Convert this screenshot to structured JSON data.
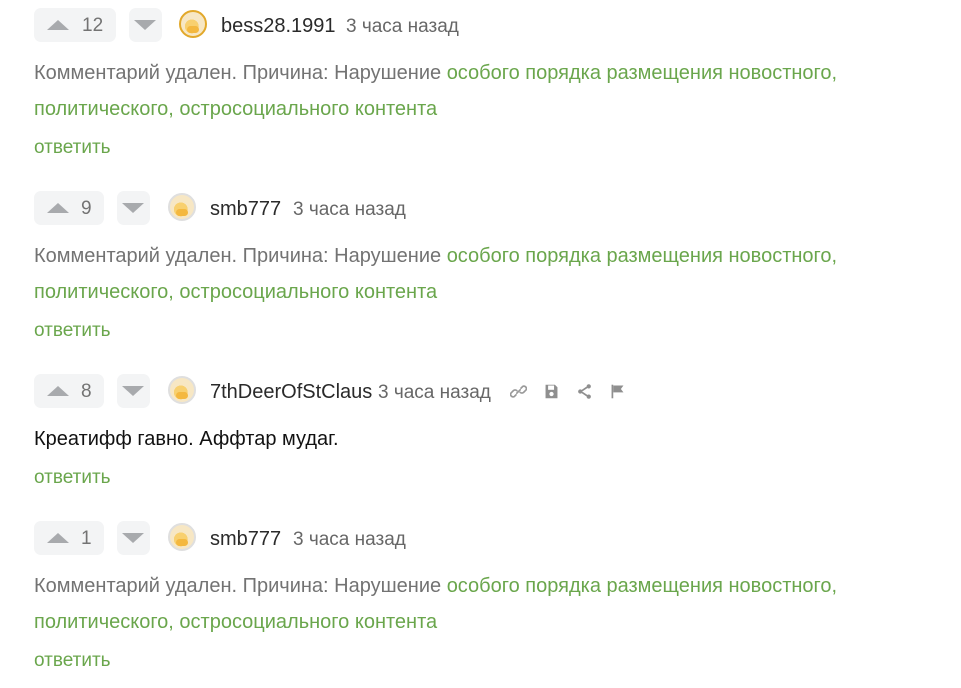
{
  "comments": [
    {
      "score": "12",
      "username": "bess28.1991",
      "time": "3 часа назад",
      "deleted": true,
      "text_prefix": "Комментарий удален. Причина: Нарушение",
      "text_link": "особого порядка размещения новостного, политического, остросоциального контента",
      "reply_label": "ответить"
    },
    {
      "score": "9",
      "username": "smb777",
      "time": "3 часа назад",
      "deleted": true,
      "text_prefix": "Комментарий удален. Причина: Нарушение",
      "text_link": "особого порядка размещения новостного, политического, остросоциального контента",
      "reply_label": "ответить"
    },
    {
      "score": "8",
      "username": "7thDeerOfStClaus",
      "time": "3 часа назад",
      "deleted": false,
      "text": "Креатифф гавно. Аффтар мудаг.",
      "reply_label": "ответить",
      "tools": [
        "link-icon",
        "save-icon",
        "share-icon",
        "flag-icon"
      ]
    },
    {
      "score": "1",
      "username": "smb777",
      "time": "3 часа назад",
      "deleted": true,
      "text_prefix": "Комментарий удален. Причина: Нарушение",
      "text_link": "особого порядка размещения новостного, политического, остросоциального контента",
      "reply_label": "ответить"
    }
  ],
  "colors": {
    "link_green": "#6aa64c",
    "muted_text": "#737373",
    "vote_bg": "#f3f4f5",
    "avatar_gold_border": "#e2a82a"
  }
}
